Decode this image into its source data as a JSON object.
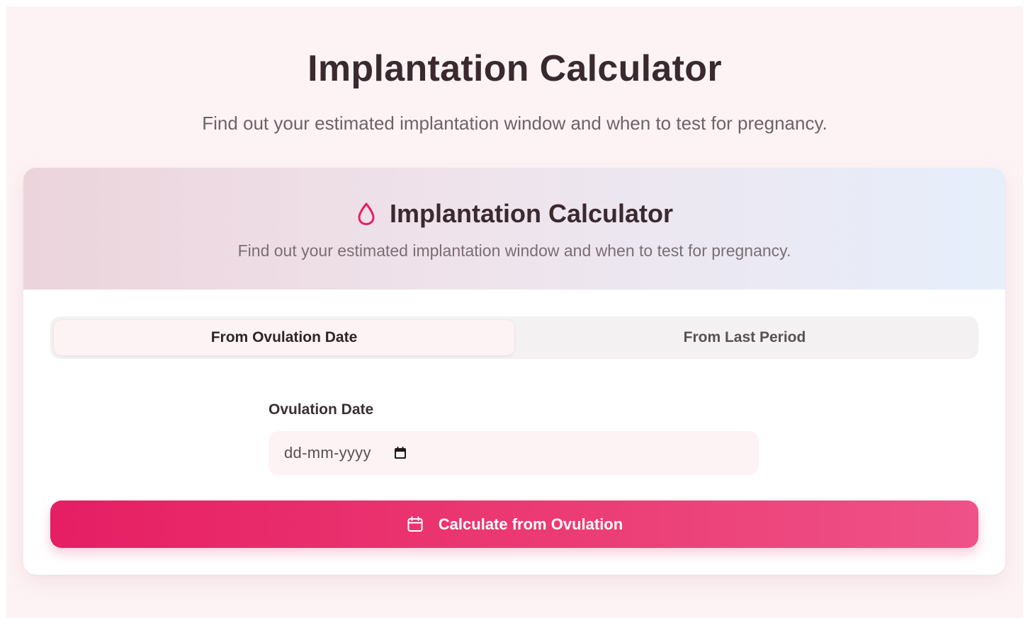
{
  "page": {
    "title": "Implantation Calculator",
    "subtitle": "Find out your estimated implantation window and when to test for pregnancy."
  },
  "card": {
    "icon": "drop-icon",
    "title": "Implantation Calculator",
    "subtitle": "Find out your estimated implantation window and when to test for pregnancy."
  },
  "tabs": [
    {
      "label": "From Ovulation Date",
      "active": true
    },
    {
      "label": "From Last Period",
      "active": false
    }
  ],
  "form": {
    "ovulation_label": "Ovulation Date",
    "ovulation_placeholder": "dd-mm-yyyy",
    "ovulation_value": "",
    "picker_icon": "calendar-icon"
  },
  "submit": {
    "icon": "calendar-icon",
    "label": "Calculate from Ovulation"
  },
  "colors": {
    "accent": "#e91e63",
    "page_background": "#fdf3f4",
    "heading": "#3a2a30"
  }
}
